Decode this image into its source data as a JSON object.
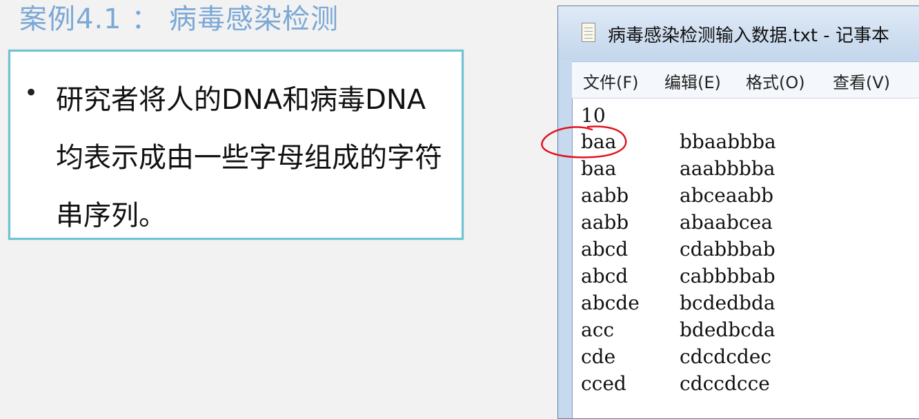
{
  "slide": {
    "title": "案例4.1 ： 病毒感染检测",
    "bullet": "研究者将人的DNA和病毒DNA均表示成由一些字母组成的字符串序列。"
  },
  "notepad": {
    "title": "病毒感染检测输入数据.txt - 记事本",
    "menu": [
      "文件(F)",
      "编辑(E)",
      "格式(O)",
      "查看(V)"
    ],
    "first_line": "10",
    "rows": [
      {
        "human": "baa",
        "virus": "bbaabbba"
      },
      {
        "human": "baa",
        "virus": "aaabbbba"
      },
      {
        "human": "aabb",
        "virus": "abceaabb"
      },
      {
        "human": "aabb",
        "virus": "abaabcea"
      },
      {
        "human": "abcd",
        "virus": "cdabbbab"
      },
      {
        "human": "abcd",
        "virus": "cabbbbab"
      },
      {
        "human": "abcde",
        "virus": "bcdedbda"
      },
      {
        "human": "acc",
        "virus": "bdedbcda"
      },
      {
        "human": "cde",
        "virus": "cdcdcdec"
      },
      {
        "human": "cced",
        "virus": "cdccdcce"
      }
    ]
  },
  "colors": {
    "title": "#7aa8d6",
    "box_border": "#6cc3d3",
    "annotation": "#e0141e"
  }
}
